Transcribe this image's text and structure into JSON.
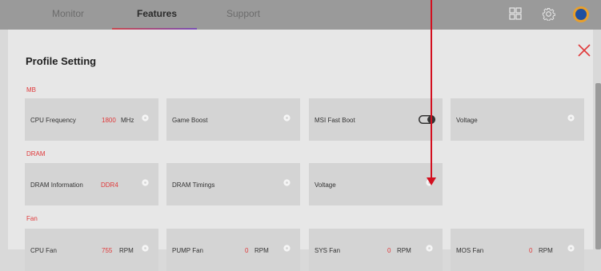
{
  "tabs": [
    {
      "label": "Monitor"
    },
    {
      "label": "Features"
    },
    {
      "label": "Support"
    }
  ],
  "panel": {
    "title": "Profile Setting"
  },
  "sections": {
    "mb": "MB",
    "dram": "DRAM",
    "fan": "Fan"
  },
  "mb_cards": {
    "cpu_frequency": {
      "label": "CPU Frequency",
      "value": "1800",
      "unit": "MHz"
    },
    "game_boost": {
      "label": "Game Boost"
    },
    "msi_fast_boot": {
      "label": "MSI Fast Boot"
    },
    "voltage": {
      "label": "Voltage"
    }
  },
  "dram_cards": {
    "dram_information": {
      "label": "DRAM Information",
      "value": "DDR4"
    },
    "dram_timings": {
      "label": "DRAM Timings"
    },
    "voltage": {
      "label": "Voltage"
    }
  },
  "fan_cards": {
    "cpu_fan": {
      "label": "CPU Fan",
      "value": "755",
      "unit": "RPM"
    },
    "pump_fan": {
      "label": "PUMP Fan",
      "value": "0",
      "unit": "RPM"
    },
    "sys_fan": {
      "label": "SYS Fan",
      "value": "0",
      "unit": "RPM"
    },
    "mos_fan": {
      "label": "MOS Fan",
      "value": "0",
      "unit": "RPM"
    }
  },
  "colors": {
    "accent_red": "#e0393a",
    "tab_bar": "#9a9a9a",
    "panel_bg": "#e7e7e7",
    "card_bg": "#d4d4d4"
  }
}
